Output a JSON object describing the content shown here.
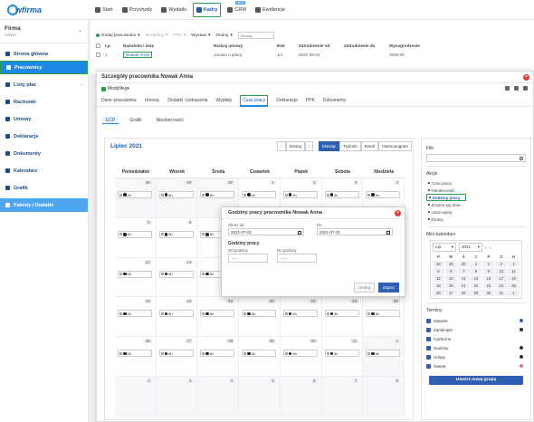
{
  "app": {
    "logo": "wfirma"
  },
  "nav": [
    {
      "label": "Start",
      "icon": "home-icon",
      "active": false
    },
    {
      "label": "Przychody",
      "icon": "income-icon",
      "active": false
    },
    {
      "label": "Wydatki",
      "icon": "expenses-icon",
      "active": false
    },
    {
      "label": "Kadry",
      "icon": "people-icon",
      "active": true
    },
    {
      "label": "CRM",
      "icon": "crm-icon",
      "active": false,
      "badge": "NEW"
    },
    {
      "label": "Ewidencje",
      "icon": "folder-icon",
      "active": false
    }
  ],
  "sidebar": {
    "company": "Firma",
    "role": "Admin",
    "items": [
      {
        "label": "Strona główna",
        "icon": "home-icon"
      },
      {
        "label": "Pracownicy",
        "icon": "users-icon",
        "selected": true
      },
      {
        "label": "Listy płac",
        "icon": "payroll-icon",
        "submenu": true
      },
      {
        "label": "Rachunki",
        "icon": "bill-icon"
      },
      {
        "label": "Umowy",
        "icon": "contract-icon"
      },
      {
        "label": "Deklaracje",
        "icon": "declaration-icon"
      },
      {
        "label": "Dokumenty",
        "icon": "document-icon"
      },
      {
        "label": "Kalendarz",
        "icon": "calendar-icon"
      },
      {
        "label": "Grafik",
        "icon": "chart-icon"
      },
      {
        "label": "Pakiety i Dodatki",
        "icon": "package-icon",
        "highlight": true
      }
    ]
  },
  "list": {
    "toolbar": {
      "add": "Dodaj pracownika",
      "modify": "Modyfikuj",
      "ppk": "PPK",
      "print_out": "Wystaw",
      "print": "Drukuj",
      "search_placeholder": "Szukaj..."
    },
    "columns": [
      "Lp.",
      "Nazwisko i imię",
      "Rodzaj umowy",
      "Etat",
      "Zatrudnienie od",
      "Zatrudnienie do",
      "Wynagrodzenie"
    ],
    "rows": [
      [
        "1",
        "Nowak Anna",
        "umowa o pracę",
        "1/1",
        "2021-06-01",
        "",
        "3500.00"
      ]
    ]
  },
  "modal": {
    "title": "Szczegóły pracownika Nowak Anna",
    "modify": "Modyfikuj",
    "tabs": [
      "Dane pracownika",
      "Umowy",
      "Dodatki i potrącenia",
      "Wypłaty",
      "Czas pracy",
      "Deklaracje",
      "PPK",
      "Dokumenty"
    ],
    "active_tab": "Czas pracy",
    "subtabs": [
      "ECP",
      "Grafik",
      "Nieobecności"
    ],
    "calendar": {
      "month": "Lipiec 2021",
      "today": "Dzisiaj",
      "views": [
        "Miesiąc",
        "Tydzień",
        "Dzień",
        "Harmonogram"
      ],
      "days": [
        "Poniedziałek",
        "Wtorek",
        "Środa",
        "Czwartek",
        "Piątek",
        "Sobota",
        "Niedziela"
      ],
      "hours_label": "8h",
      "weeks": [
        [
          "28",
          "29",
          "30",
          "1",
          "2",
          "3",
          "4"
        ],
        [
          "5",
          "6",
          "7",
          "8",
          "9",
          "10",
          "11"
        ],
        [
          "12",
          "13",
          "14",
          "15",
          "16",
          "17",
          "18"
        ],
        [
          "19",
          "20",
          "21",
          "22",
          "23",
          "24",
          "25"
        ],
        [
          "26",
          "27",
          "28",
          "29",
          "30",
          "31",
          "1"
        ],
        [
          "2",
          "3",
          "4",
          "5",
          "6",
          "7",
          "8"
        ]
      ]
    },
    "filter": {
      "title": "Filtr",
      "actions_title": "Akcje",
      "actions": [
        "Czas pracy",
        "Nieobecność",
        "Godziny pracy",
        "Zmiana typ dnia",
        "Usuń wpisy",
        "Drukuj"
      ],
      "highlighted_action": "Godziny pracy",
      "mini_title": "Mini kalendarz",
      "mini_month": "Lip",
      "mini_year": "2021",
      "mini_days": [
        "P",
        "W",
        "Ś",
        "C",
        "P",
        "S",
        "N"
      ],
      "mini_weeks": [
        [
          "28",
          "29",
          "30",
          "1",
          "2",
          "3",
          "4"
        ],
        [
          "5",
          "6",
          "7",
          "8",
          "9",
          "10",
          "11"
        ],
        [
          "12",
          "13",
          "14",
          "15",
          "16",
          "17",
          "18"
        ],
        [
          "19",
          "20",
          "21",
          "22",
          "23",
          "24",
          "25"
        ],
        [
          "26",
          "27",
          "28",
          "29",
          "30",
          "31",
          "1"
        ]
      ],
      "terms_title": "Terminy",
      "terms": [
        {
          "label": "Otwarte",
          "color": "#2f5fb3"
        },
        {
          "label": "Zamknięte",
          "color": "#333333"
        },
        {
          "label": "Cykliczne",
          "color": ""
        },
        {
          "label": "Godziny",
          "color": "#333333"
        },
        {
          "label": "Urlopy",
          "color": "#333333"
        },
        {
          "label": "Święta",
          "color": "#e57373"
        }
      ],
      "new_group": "Utwórz nową grupę"
    }
  },
  "dialog": {
    "title": "Godziny pracy pracownika Nowak Anna",
    "from_label": "Okres od",
    "from_value": "2021-07-01",
    "to_label": "Do",
    "to_value": "2021-07-01",
    "hours_title": "Godziny pracy",
    "hour_from_label": "Od godziny",
    "hour_from_value": "--:--",
    "hour_to_label": "Do godziny",
    "hour_to_value": "--:--",
    "cancel": "Anuluj",
    "save": "Zapisz"
  }
}
